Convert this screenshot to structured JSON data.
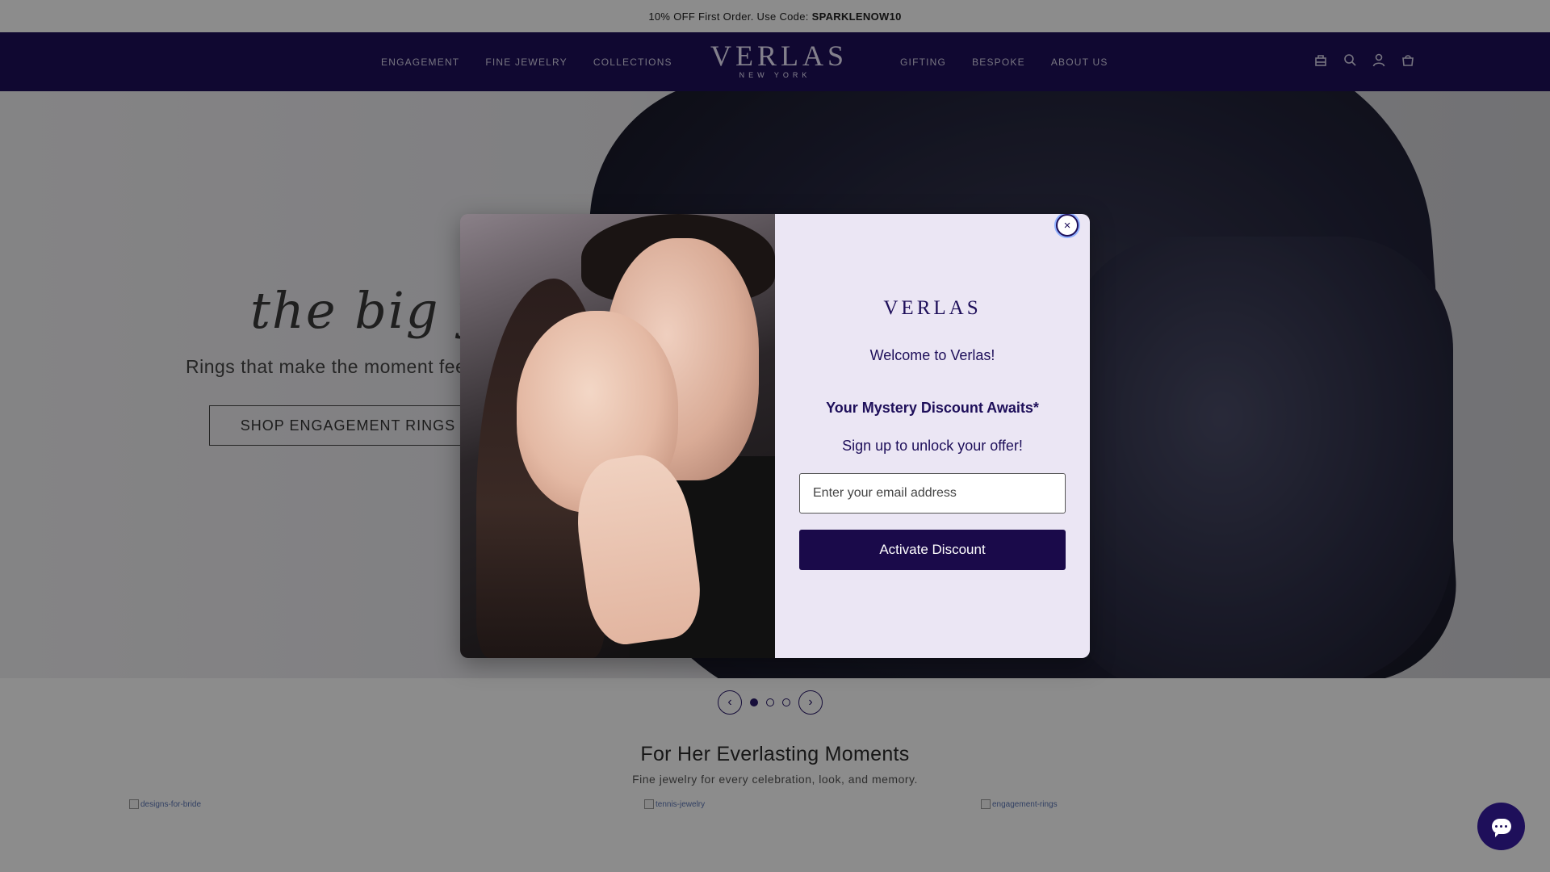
{
  "announcement": {
    "text": "10% OFF First Order. Use Code:",
    "code": "SPARKLENOW10"
  },
  "header": {
    "nav_left": [
      "ENGAGEMENT",
      "FINE JEWELRY",
      "COLLECTIONS"
    ],
    "nav_right": [
      "GIFTING",
      "BESPOKE",
      "ABOUT US"
    ],
    "logo": "VERLAS",
    "logo_sub": "NEW YORK",
    "background_color": "#1e0f5a",
    "icons": [
      "appointment-icon",
      "search-icon",
      "account-icon",
      "cart-icon"
    ]
  },
  "hero": {
    "script_title": "the big yes!",
    "subtitle": "Rings that make the moment fee",
    "cta": "SHOP ENGAGEMENT RINGS"
  },
  "carousel": {
    "slide_count": 3,
    "active_index": 0
  },
  "section": {
    "title": "For Her Everlasting Moments",
    "subtitle": "Fine jewelry for every celebration, look, and memory.",
    "image_alts": [
      "designs-for-bride",
      "tennis-jewelry",
      "engagement-rings"
    ]
  },
  "modal": {
    "logo": "VERLAS",
    "welcome": "Welcome to Verlas!",
    "heading": "Your Mystery Discount Awaits*",
    "subtext": "Sign up to unlock your offer!",
    "email_placeholder": "Enter your email address",
    "button_label": "Activate Discount",
    "close_symbol": "×",
    "panel_color": "#ebe6f4",
    "button_color": "#1a0a4a"
  },
  "chat": {
    "icon": "chat-icon"
  }
}
